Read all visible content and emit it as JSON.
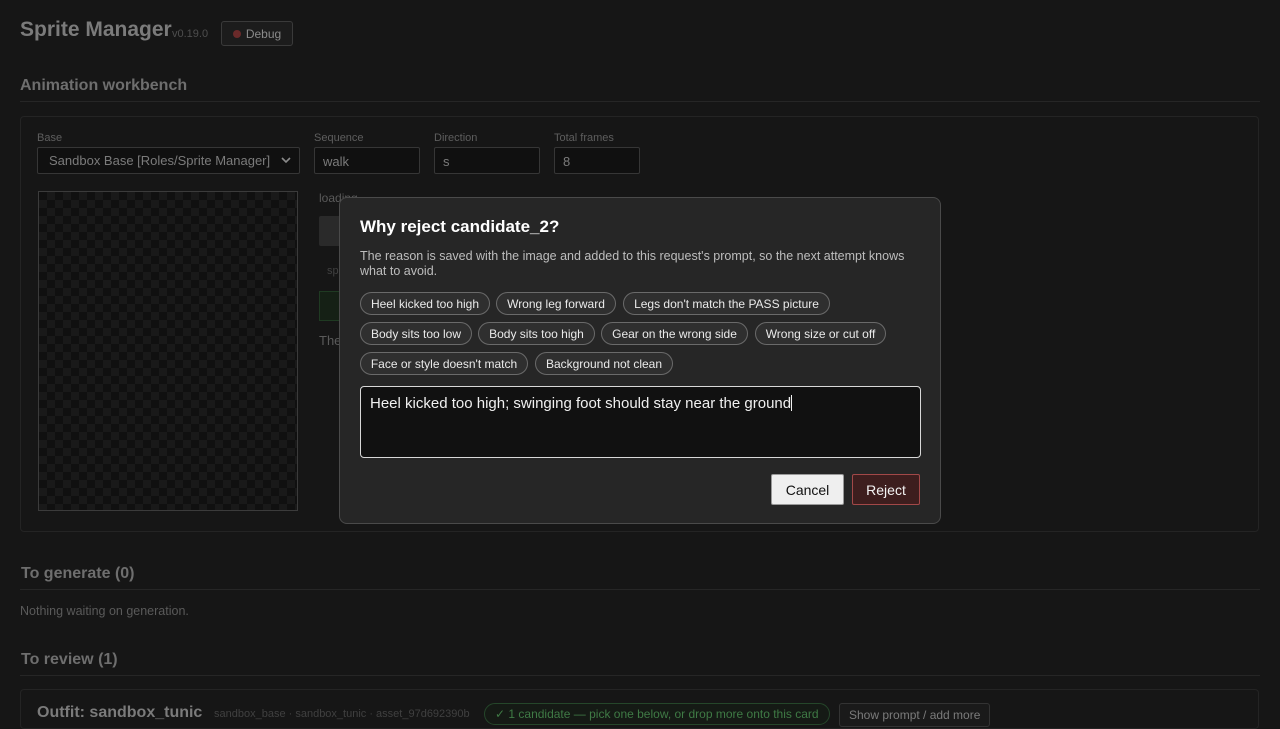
{
  "header": {
    "title": "Sprite Manager",
    "version": "v0.19.0",
    "debug_label": "Debug",
    "debug_icon": "bug-icon"
  },
  "workbench": {
    "title": "Animation workbench",
    "base_label": "Base",
    "base_value": "Sandbox Base [Roles/Sprite Manager]",
    "sequence_label": "Sequence",
    "sequence_value": "walk",
    "direction_label": "Direction",
    "direction_value": "s",
    "frames_label": "Total frames",
    "frames_value": "8",
    "status_text": "loading",
    "partial_text_1": "sp",
    "partial_text_2": "The"
  },
  "to_generate": {
    "title": "To generate (0)",
    "empty_text": "Nothing waiting on generation."
  },
  "to_review": {
    "title": "To review (1)",
    "outfit_title": "Outfit: sandbox_tunic",
    "meta": "sandbox_base · sandbox_tunic · asset_97d692390b",
    "candidate_badge": "✓ 1 candidate — pick one below, or drop more onto this card",
    "show_prompt_label": "Show prompt / add more"
  },
  "modal": {
    "title": "Why reject candidate_2?",
    "description": "The reason is saved with the image and added to this request's prompt, so the next attempt knows what to avoid.",
    "chips": [
      "Heel kicked too high",
      "Wrong leg forward",
      "Legs don't match the PASS picture",
      "Body sits too low",
      "Body sits too high",
      "Gear on the wrong side",
      "Wrong size or cut off",
      "Face or style doesn't match",
      "Background not clean"
    ],
    "reason_value": "Heel kicked too high; swinging foot should stay near the ground",
    "cancel_label": "Cancel",
    "reject_label": "Reject"
  },
  "colors": {
    "reject_accent": "#a24848",
    "candidate_green": "#3f7a45"
  }
}
